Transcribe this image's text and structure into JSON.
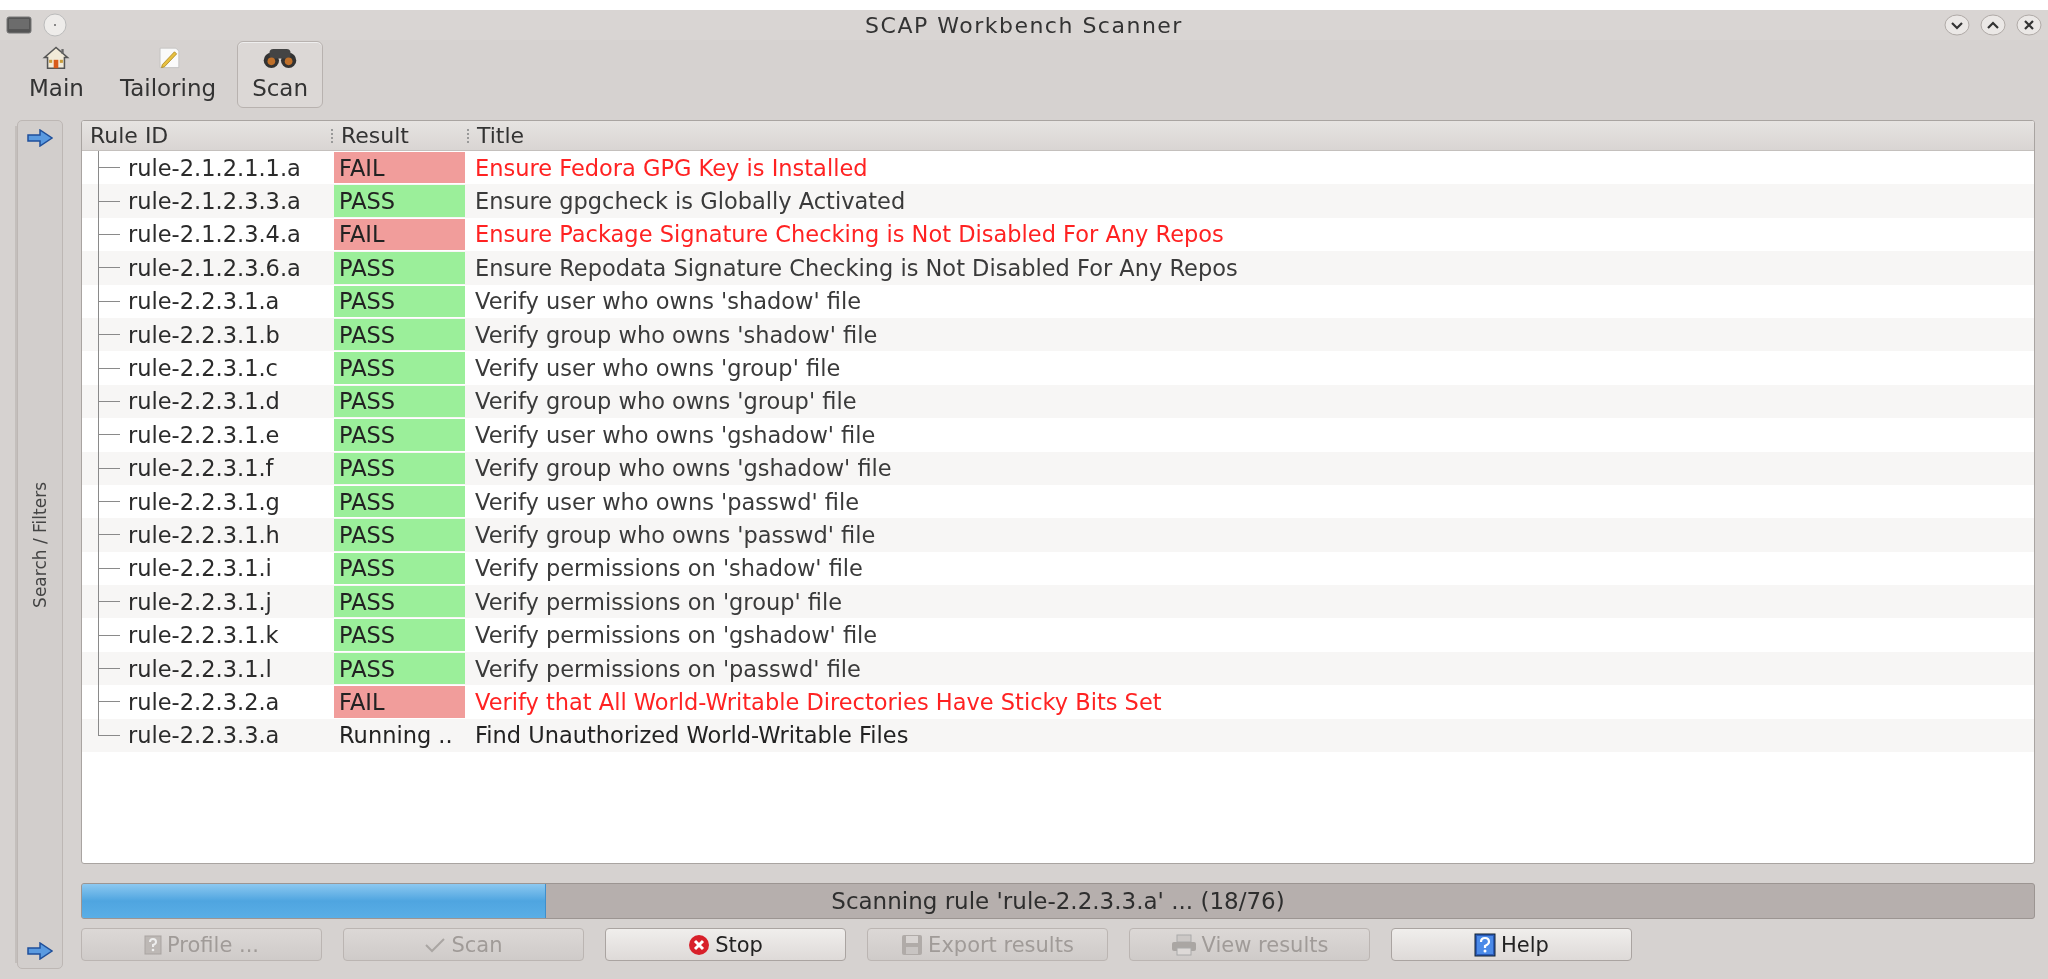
{
  "window": {
    "title": "SCAP Workbench Scanner"
  },
  "toolbar": {
    "tabs": [
      {
        "label": "Main",
        "kind": "home",
        "selected": false
      },
      {
        "label": "Tailoring",
        "kind": "tailoring",
        "selected": false
      },
      {
        "label": "Scan",
        "kind": "scan",
        "selected": true
      }
    ]
  },
  "sidebar": {
    "label": "Search / Filters"
  },
  "table": {
    "columns": [
      "Rule ID",
      "Result",
      "Title"
    ],
    "rows": [
      {
        "rule_id": "rule-2.1.2.1.1.a",
        "result": "FAIL",
        "kind": "fail",
        "title": "Ensure Fedora GPG Key is Installed"
      },
      {
        "rule_id": "rule-2.1.2.3.3.a",
        "result": "PASS",
        "kind": "pass",
        "title": "Ensure gpgcheck is Globally Activated"
      },
      {
        "rule_id": "rule-2.1.2.3.4.a",
        "result": "FAIL",
        "kind": "fail",
        "title": "Ensure Package Signature Checking is Not Disabled For Any Repos"
      },
      {
        "rule_id": "rule-2.1.2.3.6.a",
        "result": "PASS",
        "kind": "pass",
        "title": "Ensure Repodata Signature Checking is Not Disabled For Any Repos"
      },
      {
        "rule_id": "rule-2.2.3.1.a",
        "result": "PASS",
        "kind": "pass",
        "title": "Verify user who owns 'shadow' file"
      },
      {
        "rule_id": "rule-2.2.3.1.b",
        "result": "PASS",
        "kind": "pass",
        "title": "Verify group who owns 'shadow' file"
      },
      {
        "rule_id": "rule-2.2.3.1.c",
        "result": "PASS",
        "kind": "pass",
        "title": "Verify user who owns 'group' file"
      },
      {
        "rule_id": "rule-2.2.3.1.d",
        "result": "PASS",
        "kind": "pass",
        "title": "Verify group who owns 'group' file"
      },
      {
        "rule_id": "rule-2.2.3.1.e",
        "result": "PASS",
        "kind": "pass",
        "title": "Verify user who owns 'gshadow' file"
      },
      {
        "rule_id": "rule-2.2.3.1.f",
        "result": "PASS",
        "kind": "pass",
        "title": "Verify group who owns 'gshadow' file"
      },
      {
        "rule_id": "rule-2.2.3.1.g",
        "result": "PASS",
        "kind": "pass",
        "title": "Verify user who owns 'passwd' file"
      },
      {
        "rule_id": "rule-2.2.3.1.h",
        "result": "PASS",
        "kind": "pass",
        "title": "Verify group who owns 'passwd' file"
      },
      {
        "rule_id": "rule-2.2.3.1.i",
        "result": "PASS",
        "kind": "pass",
        "title": "Verify permissions on 'shadow' file"
      },
      {
        "rule_id": "rule-2.2.3.1.j",
        "result": "PASS",
        "kind": "pass",
        "title": "Verify permissions on 'group' file"
      },
      {
        "rule_id": "rule-2.2.3.1.k",
        "result": "PASS",
        "kind": "pass",
        "title": "Verify permissions on 'gshadow' file"
      },
      {
        "rule_id": "rule-2.2.3.1.l",
        "result": "PASS",
        "kind": "pass",
        "title": "Verify permissions on 'passwd' file"
      },
      {
        "rule_id": "rule-2.2.3.2.a",
        "result": "FAIL",
        "kind": "fail",
        "title": "Verify that All World-Writable Directories Have Sticky Bits Set"
      },
      {
        "rule_id": "rule-2.2.3.3.a",
        "result": "Running ..",
        "kind": "running",
        "title": "Find Unauthorized World-Writable Files"
      }
    ]
  },
  "progress": {
    "level": 0.237,
    "text": "Scanning rule 'rule-2.2.3.3.a' ... (18/76)"
  },
  "buttons": [
    {
      "label": "Profile ...",
      "kind": "profile",
      "disabled": true
    },
    {
      "label": "Scan",
      "kind": "scan",
      "disabled": true
    },
    {
      "label": "Stop",
      "kind": "stop",
      "disabled": false
    },
    {
      "label": "Export results",
      "kind": "export",
      "disabled": true
    },
    {
      "label": "View results",
      "kind": "view",
      "disabled": true
    },
    {
      "label": "Help",
      "kind": "help",
      "disabled": false
    }
  ]
}
